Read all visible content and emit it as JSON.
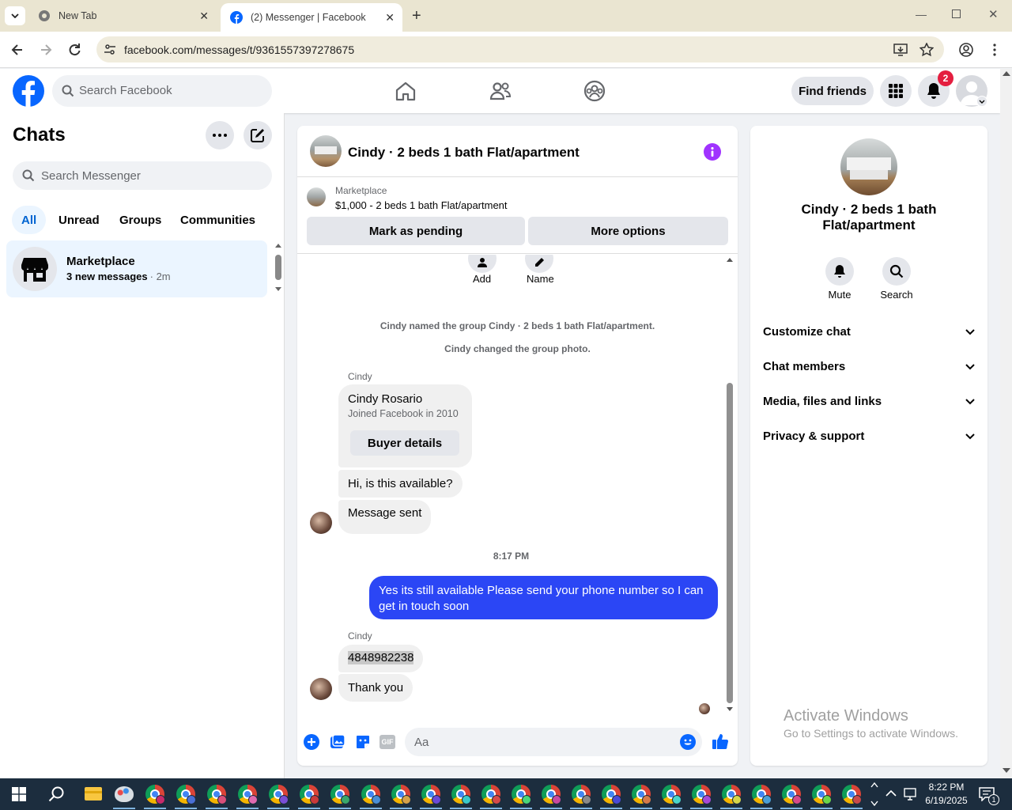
{
  "browser": {
    "tabs": [
      {
        "title": "New Tab"
      },
      {
        "title": "(2) Messenger | Facebook"
      }
    ],
    "url": "facebook.com/messages/t/9361557397278675"
  },
  "fb_header": {
    "search_placeholder": "Search Facebook",
    "find_friends_label": "Find friends",
    "notification_count": "2"
  },
  "left_panel": {
    "title": "Chats",
    "search_placeholder": "Search Messenger",
    "filters": [
      "All",
      "Unread",
      "Groups",
      "Communities"
    ],
    "active_filter": "All",
    "chats": [
      {
        "name": "Marketplace",
        "preview": "3 new messages",
        "time": "· 2m"
      }
    ]
  },
  "conversation": {
    "title": "Cindy · 2 beds 1 bath Flat/apartment",
    "listing_source": "Marketplace",
    "listing_summary": "$1,000 - 2 beds 1 bath Flat/apartment",
    "mark_pending_label": "Mark as pending",
    "more_options_label": "More options",
    "quick_actions": [
      "Add",
      "Name"
    ],
    "system_messages": [
      "Cindy named the group Cindy · 2 beds 1 bath Flat/apartment.",
      "Cindy changed the group photo."
    ],
    "buyer_card": {
      "sender": "Cindy",
      "name": "Cindy Rosario",
      "joined": "Joined Facebook in 2010",
      "button": "Buyer details"
    },
    "incoming_1": "Hi, is this available?",
    "incoming_2": "Message sent",
    "timestamp": "8:17 PM",
    "outgoing": "Yes its still available Please send your phone number so I can get in touch soon",
    "sender_2": "Cindy",
    "incoming_3": "4848982238",
    "incoming_4": "Thank you",
    "composer_placeholder": "Aa"
  },
  "right_panel": {
    "title": "Cindy · 2 beds 1 bath Flat/apartment",
    "actions": [
      "Mute",
      "Search"
    ],
    "sections": [
      "Customize chat",
      "Chat members",
      "Media, files and links",
      "Privacy & support"
    ],
    "watermark_title": "Activate Windows",
    "watermark_sub": "Go to Settings to activate Windows."
  },
  "taskbar": {
    "time": "8:22 PM",
    "date": "6/19/2025",
    "notification_count": "1"
  },
  "colors": {
    "fb_blue": "#0866ff",
    "bubble_out": "#2b46f5",
    "badge_red": "#e41e3f",
    "info_purple": "#a033ff"
  }
}
